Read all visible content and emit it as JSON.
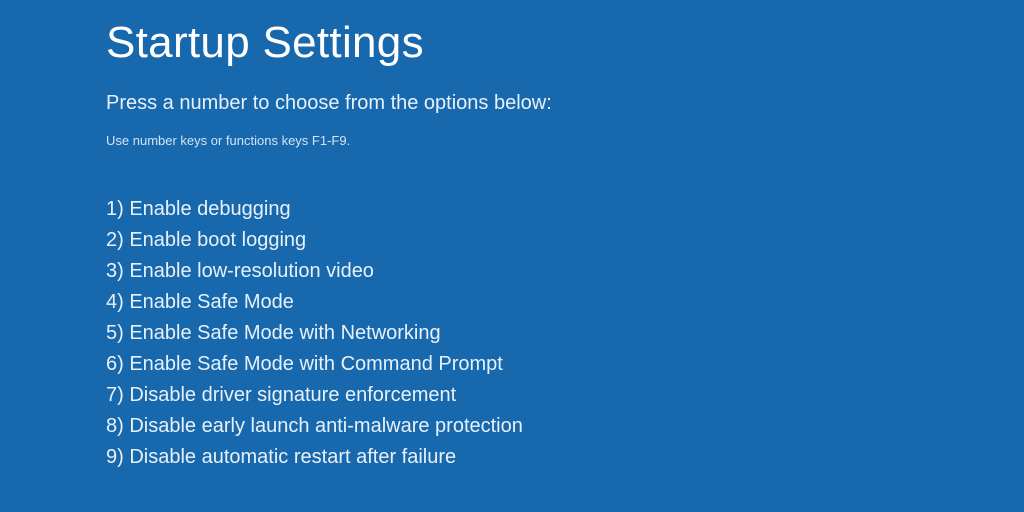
{
  "title": "Startup Settings",
  "prompt": "Press a number to choose from the options below:",
  "hint": "Use number keys or functions keys F1-F9.",
  "options": [
    {
      "number": "1",
      "label": "Enable debugging"
    },
    {
      "number": "2",
      "label": "Enable boot logging"
    },
    {
      "number": "3",
      "label": "Enable low-resolution video"
    },
    {
      "number": "4",
      "label": "Enable Safe Mode"
    },
    {
      "number": "5",
      "label": "Enable Safe Mode with Networking"
    },
    {
      "number": "6",
      "label": "Enable Safe Mode with Command Prompt"
    },
    {
      "number": "7",
      "label": "Disable driver signature enforcement"
    },
    {
      "number": "8",
      "label": "Disable early launch anti-malware protection"
    },
    {
      "number": "9",
      "label": "Disable automatic restart after failure"
    }
  ]
}
